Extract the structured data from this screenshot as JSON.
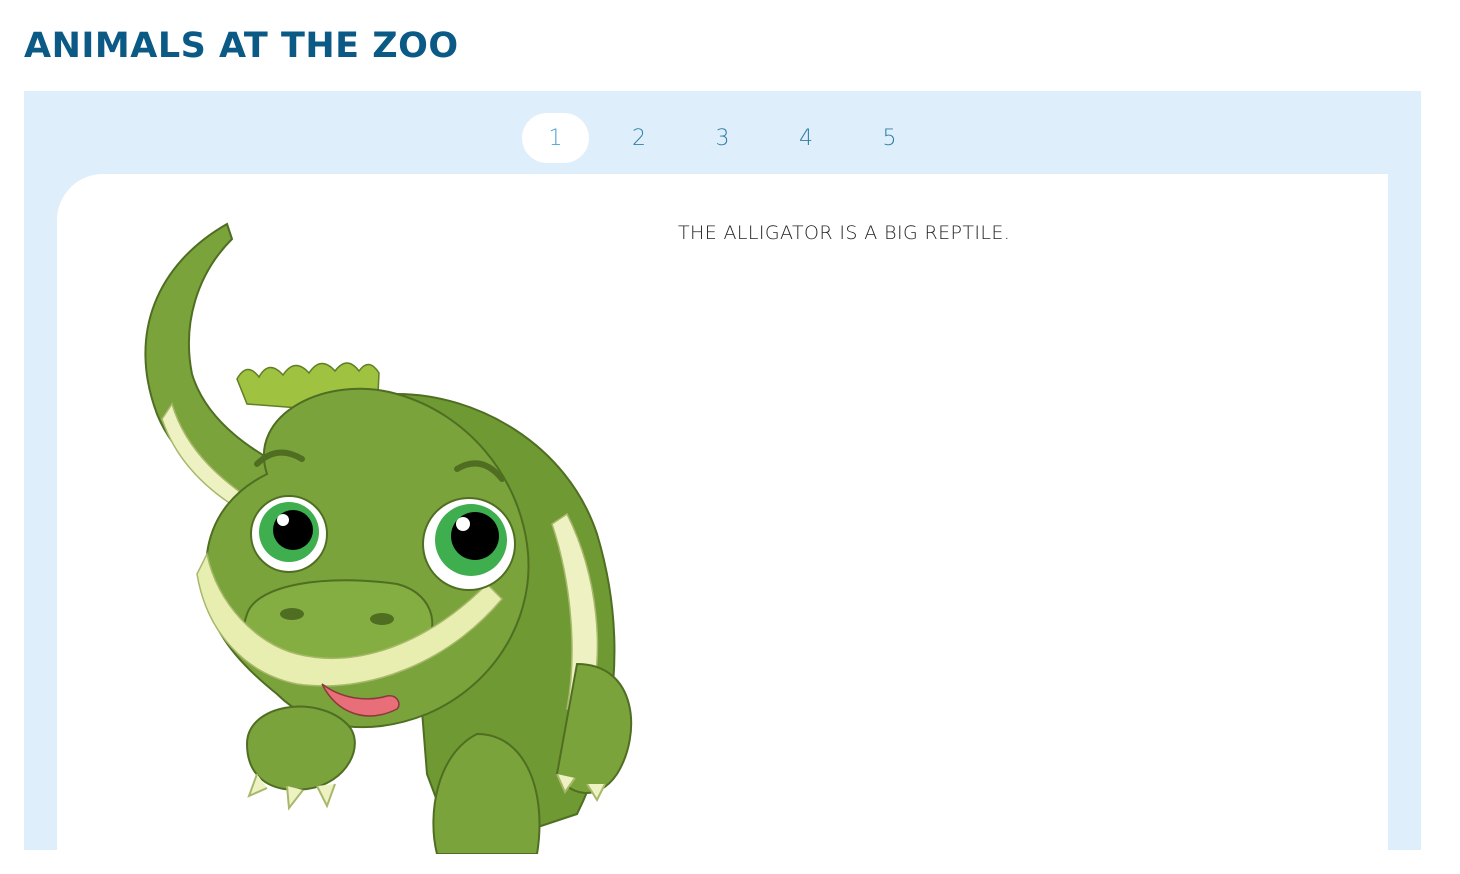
{
  "page": {
    "title": "ANIMALS AT THE ZOO"
  },
  "pager": {
    "pages": [
      "1",
      "2",
      "3",
      "4",
      "5"
    ],
    "active_index": 0
  },
  "slide": {
    "text": "THE ALLIGATOR IS A BIG REPTILE.",
    "image": "cartoon-alligator"
  },
  "colors": {
    "title": "#0b5a86",
    "panel_bg": "#dfeefb",
    "pager_text": "#2f7fa6",
    "pager_active_text": "#4aa3cc",
    "alligator_green": "#7aa33c"
  }
}
